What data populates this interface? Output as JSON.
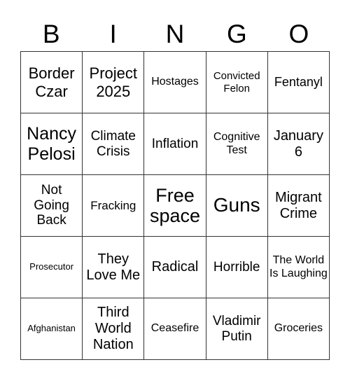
{
  "header": {
    "letters": [
      "B",
      "I",
      "N",
      "G",
      "O"
    ]
  },
  "cells": [
    [
      "Border Czar",
      "Project 2025",
      "Hostages",
      "Convicted Felon",
      "Fentanyl"
    ],
    [
      "Nancy Pelosi",
      "Climate Crisis",
      "Inflation",
      "Cognitive Test",
      "January 6"
    ],
    [
      "Not Going Back",
      "Fracking",
      "Free space",
      "Guns",
      "Migrant Crime"
    ],
    [
      "Prosecutor",
      "They Love Me",
      "Radical",
      "Horrible",
      "The World Is Laughing"
    ],
    [
      "Afghanistan",
      "Third World Nation",
      "Ceasefire",
      "Vladimir Putin",
      "Groceries"
    ]
  ]
}
